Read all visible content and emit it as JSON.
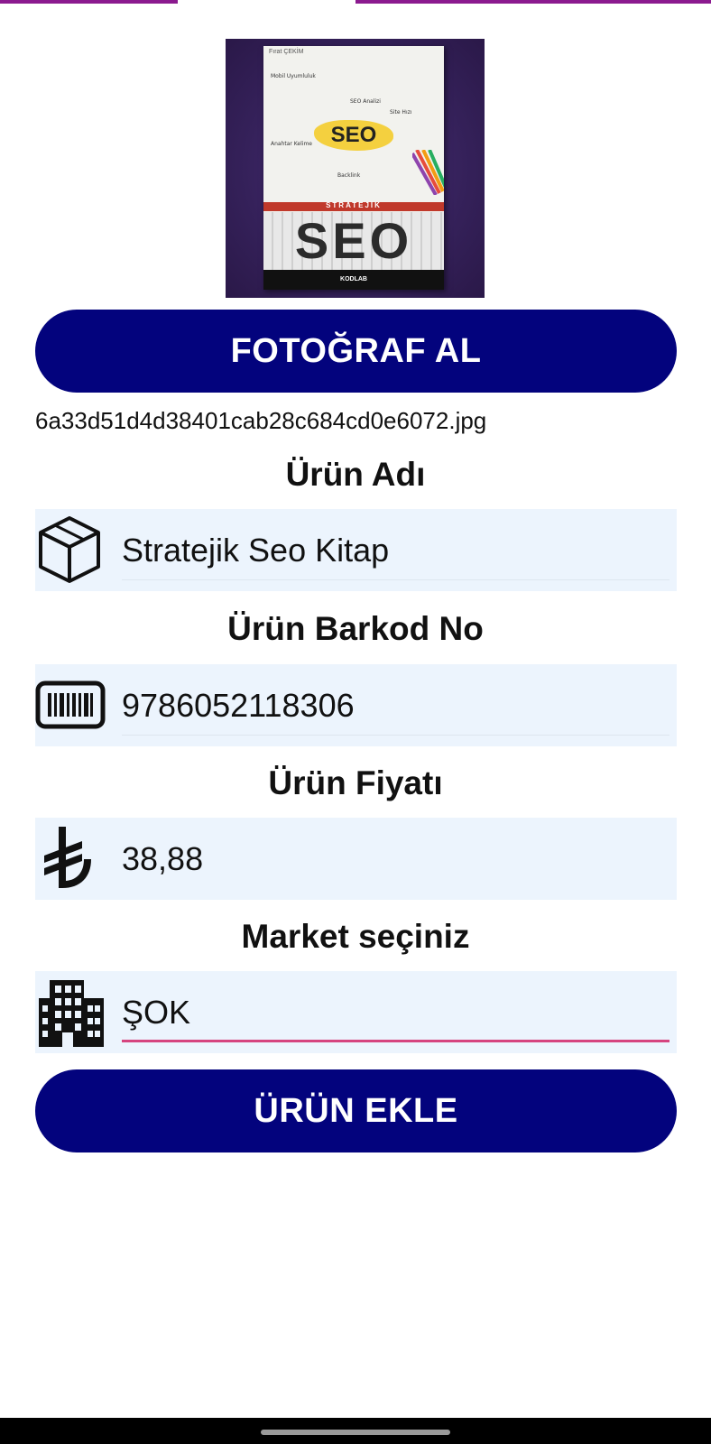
{
  "photo": {
    "book_author": "Fırat ÇEKİM",
    "book_seo_small": "SEO",
    "book_band": "STRATEJİK",
    "book_seo_big": "SEO",
    "book_publisher": "KODLAB",
    "scribbles": [
      "SEO Analizi",
      "Backlink",
      "Mobil Uyumluluk",
      "Site Hızı",
      "Anahtar Kelime"
    ]
  },
  "buttons": {
    "take_photo": "FOTOĞRAF AL",
    "add_product": "ÜRÜN EKLE"
  },
  "filename": "6a33d51d4d38401cab28c684cd0e6072.jpg",
  "fields": {
    "name": {
      "label": "Ürün Adı",
      "value": "Stratejik Seo Kitap",
      "icon": "box-icon"
    },
    "barcode": {
      "label": "Ürün Barkod No",
      "value": "9786052118306",
      "icon": "barcode-icon"
    },
    "price": {
      "label": "Ürün Fiyatı",
      "value": "38,88",
      "icon": "lira-icon"
    },
    "market": {
      "label": "Market seçiniz",
      "value": "ŞOK",
      "icon": "building-icon"
    }
  },
  "colors": {
    "button_bg": "#03037d",
    "field_bg": "#ecf4fd",
    "accent_underline": "#d6457f",
    "top_strip": "#8b1a8f"
  }
}
